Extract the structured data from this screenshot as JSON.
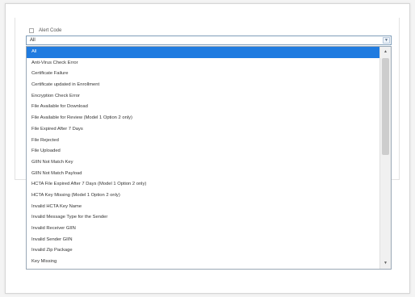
{
  "alert": {
    "label": "Alert Code"
  },
  "select": {
    "value": "All"
  },
  "options": [
    "All",
    "Anti-Virus Check Error",
    "Certificate Failure",
    "Certificate updated in Enrollment",
    "Encryption Check Error",
    "File Available for Download",
    "File Available for Review (Model 1 Option 2 only)",
    "File Expired After 7 Days",
    "File Rejected",
    "File Uploaded",
    "GIIN Not Match Key",
    "GIIN Not Match Payload",
    "HCTA File Expired After 7 Days (Model 1 Option 2 only)",
    "HCTA Key Missing (Model 1 Option 2 only)",
    "Invalid HCTA Key Name",
    "Invalid Message Type for the Sender",
    "Invalid Receiver GIIN",
    "Invalid Sender GIIN",
    "Invalid Zip Package",
    "Key Missing"
  ],
  "selected_index": 0,
  "icons": {
    "dropdown": "chevron-down-icon",
    "scroll_up": "chevron-up-icon",
    "scroll_down": "chevron-down-icon"
  },
  "colors": {
    "selected": "#1f7be0"
  }
}
